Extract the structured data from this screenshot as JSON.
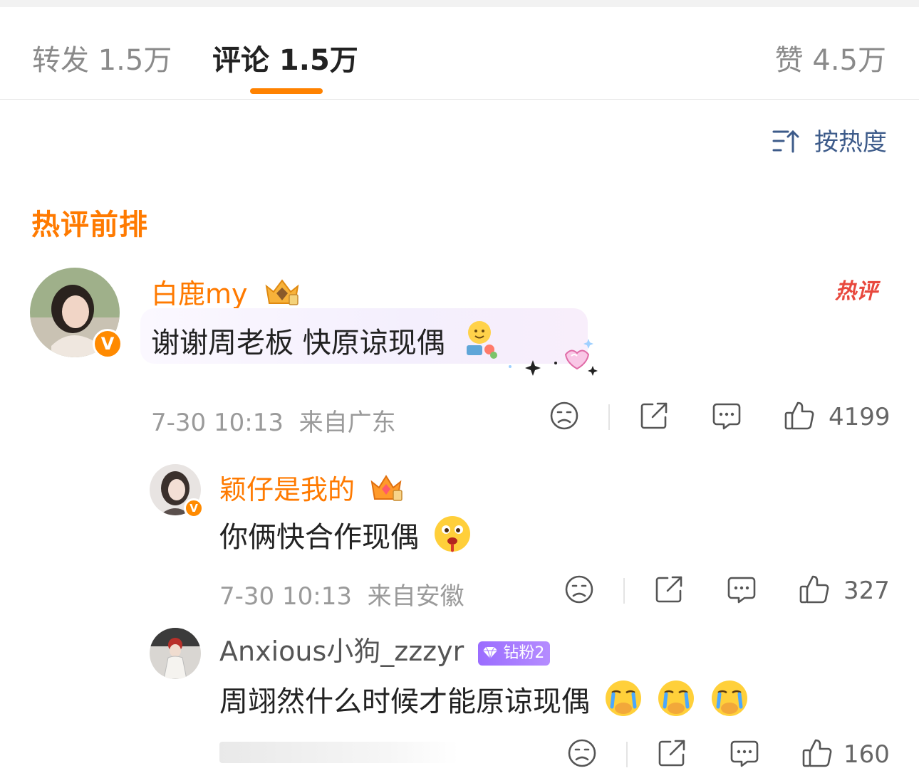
{
  "tabs": [
    {
      "label": "转发 1.5万",
      "active": false
    },
    {
      "label": "评论 1.5万",
      "active": true
    },
    {
      "label": "赞 4.5万",
      "active": false
    }
  ],
  "sort": {
    "label": "按热度",
    "icon": "sort-icon"
  },
  "section_title": "热评前排",
  "hot_tag": "热评",
  "comments": [
    {
      "username": "白鹿my",
      "text": "谢谢周老板 快原谅现偶",
      "time": "7-30 10:13",
      "location": "来自广东",
      "likes": "4199",
      "verified_badge": "V"
    },
    {
      "username": "颖仔是我的",
      "text": "你俩快合作现偶",
      "time": "7-30 10:13",
      "location": "来自安徽",
      "likes": "327",
      "verified_badge": "V"
    },
    {
      "username": "Anxious小狗_zzzyr",
      "fan_badge": "钻粉2",
      "text": "周翊然什么时候才能原谅现偶",
      "likes": "160"
    }
  ],
  "colors": {
    "accent": "#ff8200",
    "username": "#ff7a00",
    "link": "#3d5b8a",
    "hot": "#e8483d"
  }
}
